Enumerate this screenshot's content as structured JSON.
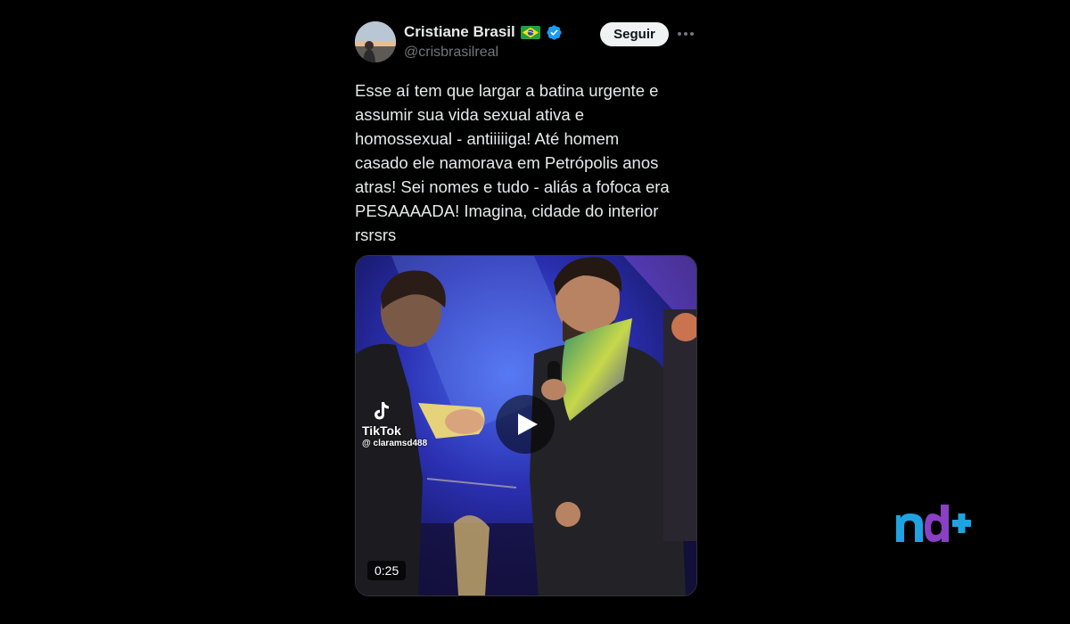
{
  "tweet": {
    "display_name": "Cristiane Brasil",
    "handle": "@crisbrasilreal",
    "follow_label": "Seguir",
    "text": "Esse aí tem que largar a batina urgente e\nassumir sua vida sexual ativa e\nhomossexual - antiiiiiga! Até homem\ncasado ele namorava em Petrópolis anos\natras! Sei nomes e tudo - aliás a fofoca era\nPESAAAADA! Imagina, cidade do interior\nrsrsrs"
  },
  "media": {
    "watermark_label": "TikTok",
    "watermark_user": "@ claramsd488",
    "duration": "0:25"
  },
  "icons": {
    "flag": "brazil-flag-icon",
    "verified": "verified-badge-icon",
    "more": "more-options-icon",
    "play": "play-icon",
    "tiktok": "tiktok-logo-icon"
  },
  "colors": {
    "background": "#000000",
    "text": "#e7e9ea",
    "secondary_text": "#71767b",
    "verified": "#1d9bf0",
    "follow_button_bg": "#eff3f4",
    "brand_blue": "#1fa2e0",
    "brand_purple": "#8a3fc4"
  }
}
